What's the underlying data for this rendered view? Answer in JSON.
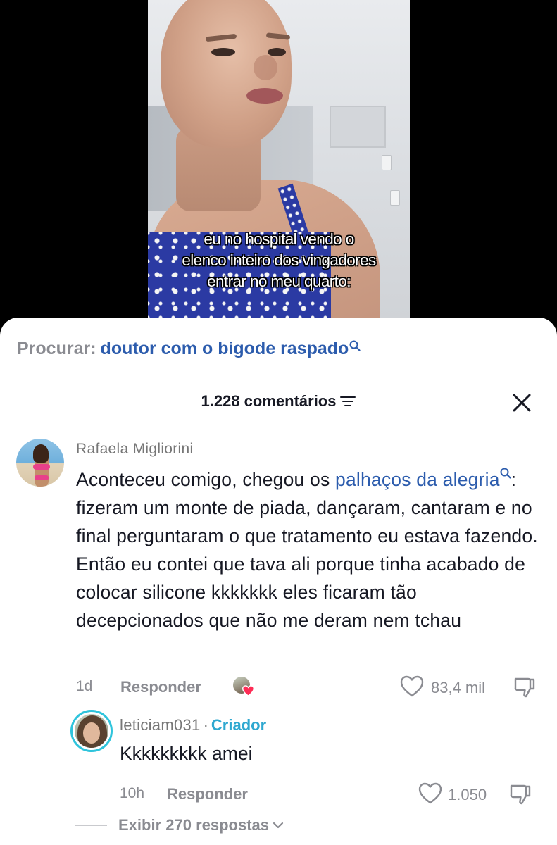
{
  "video": {
    "caption_lines": [
      "eu no hospital vendo o",
      "elenco inteiro dos vingadores",
      "entrar no meu quarto:"
    ]
  },
  "search": {
    "prefix": "Procurar:",
    "term": "doutor com o bigode raspado",
    "icon": "search-icon"
  },
  "comments_panel": {
    "count_label": "1.228 comentários",
    "sort_icon": "sort-icon",
    "close_icon": "close-icon"
  },
  "comment": {
    "username": "Rafaela Migliorini",
    "text_before_link": "Aconteceu comigo, chegou os ",
    "link_text": "palhaços da alegria",
    "text_after_link": ": fizeram um monte de piada, dançaram, cantaram e no final perguntaram o que tratamento eu estava fazendo. Então eu contei que tava ali porque tinha acabado de colocar silicone kkkkkkk eles ficaram tão decepcionados que não me deram nem tchau",
    "time": "1d",
    "reply_label": "Responder",
    "likes": "83,4 mil",
    "like_icon": "heart-outline-icon",
    "dislike_icon": "thumbs-down-icon"
  },
  "reply": {
    "username": "leticiam031",
    "separator": "·",
    "badge": "Criador",
    "text": "Kkkkkkkkk amei",
    "time": "10h",
    "reply_label": "Responder",
    "likes": "1.050"
  },
  "view_replies": {
    "label": "Exibir 270 respostas"
  },
  "colors": {
    "link_blue": "#2c5cad",
    "creator_cyan": "#2fa8d0",
    "muted_gray": "#8a8b91",
    "text_dark": "#161823",
    "liked_heart": "#fe2c55"
  }
}
